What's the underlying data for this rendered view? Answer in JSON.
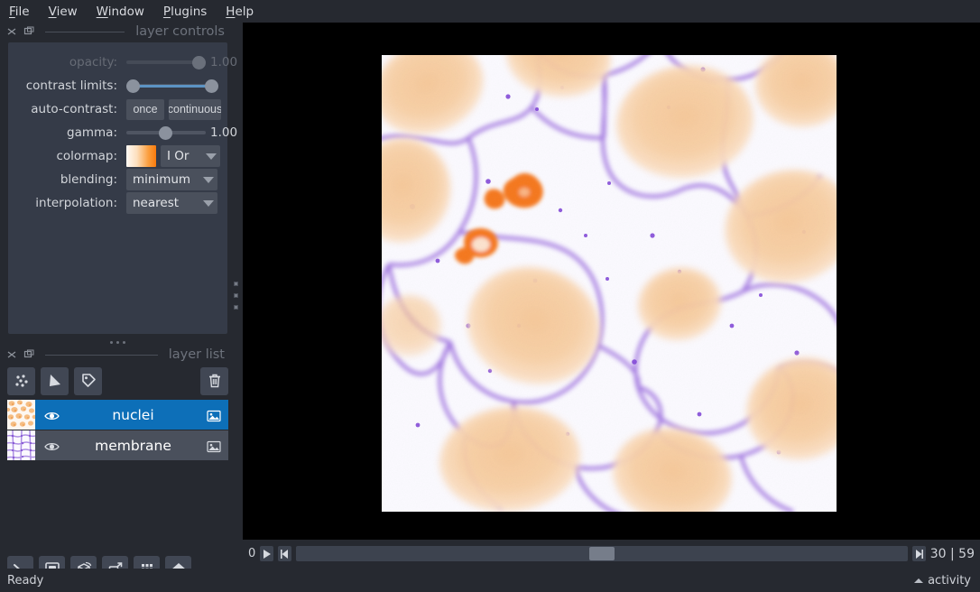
{
  "menubar": {
    "items": [
      {
        "label": "File",
        "accel": "F"
      },
      {
        "label": "View",
        "accel": "V"
      },
      {
        "label": "Window",
        "accel": "W"
      },
      {
        "label": "Plugins",
        "accel": "P"
      },
      {
        "label": "Help",
        "accel": "H"
      }
    ]
  },
  "layer_controls": {
    "dock_title": "layer controls",
    "opacity": {
      "label": "opacity:",
      "value": "1.00",
      "enabled": false,
      "fill_percent": 88
    },
    "contrast_limits": {
      "label": "contrast limits:",
      "low_percent": 0,
      "high_percent": 100
    },
    "auto_contrast": {
      "label": "auto-contrast:",
      "once": "once",
      "continuous": "continuous"
    },
    "gamma": {
      "label": "gamma:",
      "value": "1.00",
      "fill_percent": 48
    },
    "colormap": {
      "label": "colormap:",
      "value": "I Or",
      "swatch_from": "#fffaf5",
      "swatch_to": "#f97b0d"
    },
    "blending": {
      "label": "blending:",
      "value": "minimum"
    },
    "interpolation": {
      "label": "interpolation:",
      "value": "nearest"
    }
  },
  "layer_list": {
    "dock_title": "layer list",
    "tools": [
      {
        "name": "new-points-layer",
        "tooltip": "New points layer"
      },
      {
        "name": "new-shapes-layer",
        "tooltip": "New shapes layer"
      },
      {
        "name": "new-labels-layer",
        "tooltip": "New labels layer"
      },
      {
        "name": "delete-layer",
        "tooltip": "Delete selected layer"
      }
    ],
    "layers": [
      {
        "name": "nuclei",
        "selected": true,
        "visible": true,
        "type_icon": "image-icon"
      },
      {
        "name": "membrane",
        "selected": false,
        "visible": true,
        "type_icon": "image-icon"
      }
    ]
  },
  "viewer_buttons": [
    {
      "name": "console-button",
      "label": "console"
    },
    {
      "name": "ndisplay-toggle-button",
      "label": "2D/3D"
    },
    {
      "name": "roll-dims-button",
      "label": "roll dimensions"
    },
    {
      "name": "transpose-dims-button",
      "label": "transpose dimensions"
    },
    {
      "name": "grid-view-button",
      "label": "grid view"
    },
    {
      "name": "home-button",
      "label": "reset view"
    }
  ],
  "dims": {
    "axis_label": "0",
    "play_label": "play",
    "step_back_label": "step back",
    "step_forward_label": "step forward",
    "current": "30",
    "separator": "|",
    "total": "59",
    "handle_percent": 50
  },
  "statusbar": {
    "status": "Ready",
    "activity": "activity"
  },
  "colors": {
    "window_bg": "#262930",
    "panel_bg": "#353b48",
    "control_bg": "#4a505c",
    "selection_blue": "#0d6fb8",
    "text": "#d2d5da",
    "dim_text": "#6d727c"
  }
}
